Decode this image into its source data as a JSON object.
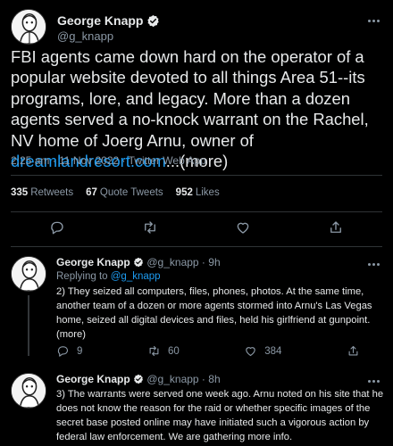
{
  "author": {
    "name": "George Knapp",
    "handle": "@g_knapp"
  },
  "main_tweet": {
    "text_before_link": "FBI agents came down hard on the operator of a popular website devoted to all things Area 51--its programs, lore, and legacy. More than a dozen agents served a no-knock warrant on the Rachel, NV home of Joerg Arnu, owner of ",
    "link": "dreamlandresort.com",
    "text_after_link": "...(more)",
    "timestamp": "2:25 am · 11 Nov 2022 · Twitter Web App",
    "retweets_count": "335",
    "retweets_label": "Retweets",
    "quotes_count": "67",
    "quotes_label": "Quote Tweets",
    "likes_count": "952",
    "likes_label": "Likes"
  },
  "replies": [
    {
      "name": "George Knapp",
      "handle_time": "@g_knapp · 9h",
      "replying_label": "Replying to",
      "replying_to": "@g_knapp",
      "text": "2)  They seized all computers, files, phones, photos. At the same time, another team of a dozen or more agents stormed into Arnu's Las Vegas home, seized all digital devices and files, held his girlfriend at gunpoint. (more)",
      "reply_count": "9",
      "retweet_count": "60",
      "like_count": "384"
    },
    {
      "name": "George Knapp",
      "handle_time": "@g_knapp · 8h",
      "text": "3) The warrants were served one week ago. Arnu noted on his site that he does not know the reason for the raid or whether specific images of the secret base posted online may have initiated such a vigorous action by federal law enforcement. We are gathering more info."
    }
  ],
  "colors": {
    "background": "#000000",
    "text": "#e7e9ea",
    "secondary": "#8b98a5",
    "accent": "#1d9bf0",
    "divider": "#2f3336"
  },
  "icons": [
    "verified-badge-icon",
    "more-icon",
    "reply-icon",
    "retweet-icon",
    "like-icon",
    "share-icon"
  ]
}
